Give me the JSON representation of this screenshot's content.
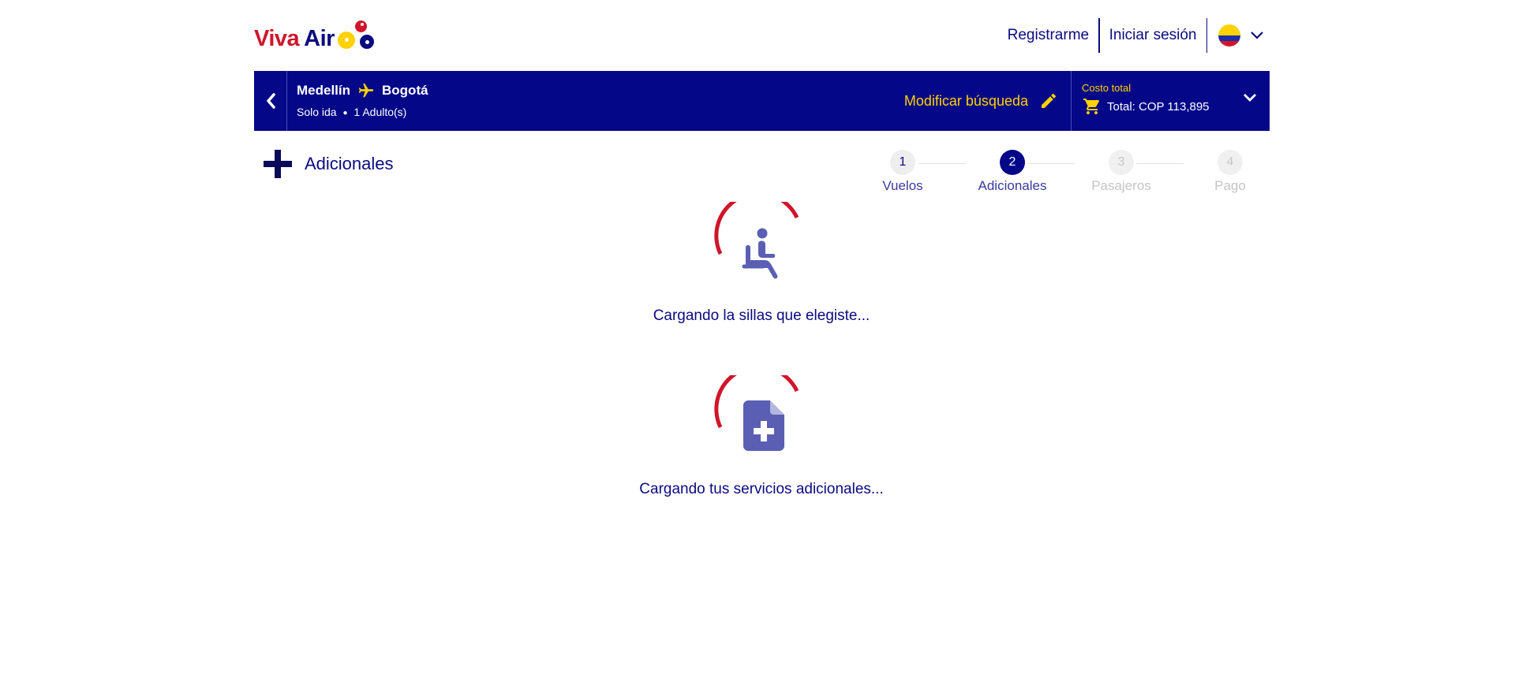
{
  "brand": {
    "name_part1": "Viva",
    "name_part2": "Air"
  },
  "header": {
    "register_label": "Registrarme",
    "login_label": "Iniciar sesión",
    "country_flag": "colombia-flag"
  },
  "booking_bar": {
    "origin": "Medellín",
    "destination": "Bogotá",
    "trip_type": "Solo ida",
    "passengers": "1 Adulto(s)",
    "modify_label": "Modificar búsqueda",
    "total_label": "Costo total",
    "total_value": "Total: COP 113,895"
  },
  "section": {
    "title": "Adicionales"
  },
  "stepper": {
    "steps": [
      {
        "number": "1",
        "label": "Vuelos",
        "state": "done"
      },
      {
        "number": "2",
        "label": "Adicionales",
        "state": "active"
      },
      {
        "number": "3",
        "label": "Pasajeros",
        "state": "pending"
      },
      {
        "number": "4",
        "label": "Pago",
        "state": "pending"
      }
    ]
  },
  "loaders": [
    {
      "icon": "seat-icon",
      "message": "Cargando la sillas que elegiste..."
    },
    {
      "icon": "add-document-icon",
      "message": "Cargando tus servicios adicionales..."
    }
  ],
  "colors": {
    "brand_blue": "#040788",
    "brand_red": "#d0152b",
    "brand_yellow": "#ffd200",
    "icon_purple": "#5a5fb4"
  }
}
